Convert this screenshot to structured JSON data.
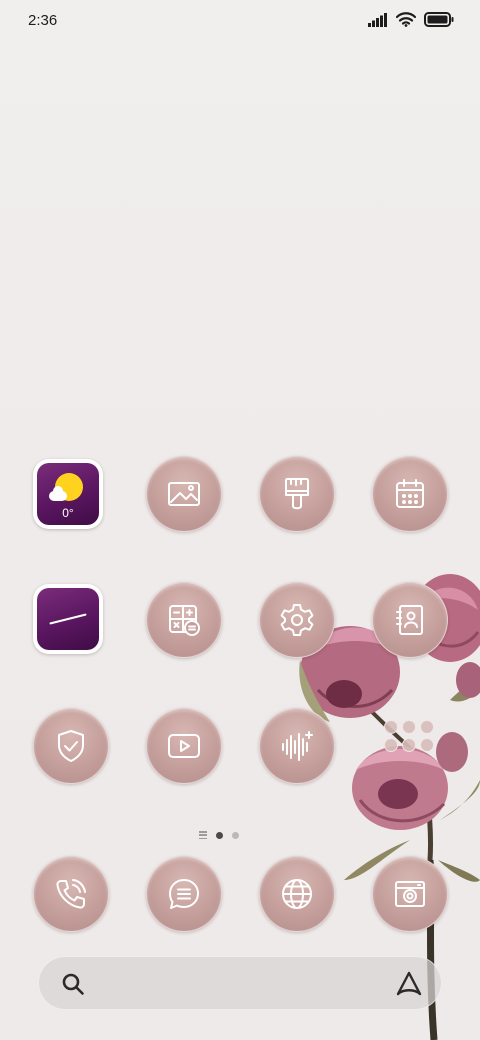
{
  "status_bar": {
    "time": "2:36",
    "icons": [
      "signal-icon",
      "wifi-icon",
      "battery-icon"
    ]
  },
  "apps": [
    {
      "id": "weather",
      "icon": "weather-icon",
      "temperature": "0°"
    },
    {
      "id": "gallery",
      "icon": "gallery-icon"
    },
    {
      "id": "themes",
      "icon": "paint-brush-icon"
    },
    {
      "id": "calendar",
      "icon": "calendar-icon"
    },
    {
      "id": "clock",
      "icon": "clock-icon"
    },
    {
      "id": "calculator",
      "icon": "calculator-icon"
    },
    {
      "id": "settings",
      "icon": "gear-icon"
    },
    {
      "id": "contacts",
      "icon": "contacts-book-icon"
    },
    {
      "id": "security",
      "icon": "shield-check-icon"
    },
    {
      "id": "video",
      "icon": "play-icon"
    },
    {
      "id": "recorder",
      "icon": "sound-wave-icon"
    },
    {
      "id": "folder",
      "icon": "folder-icon"
    }
  ],
  "page_indicator": {
    "pages": 2,
    "current": 1
  },
  "dock": [
    {
      "id": "phone",
      "icon": "phone-icon"
    },
    {
      "id": "messages",
      "icon": "message-icon"
    },
    {
      "id": "browser",
      "icon": "globe-icon"
    },
    {
      "id": "camera",
      "icon": "camera-icon"
    }
  ],
  "search": {
    "icons": [
      "search-icon",
      "assistant-icon"
    ]
  },
  "colors": {
    "wallpaper": "#efebeb",
    "icon_circle": "#c49e9a",
    "widget_purple": "#5a1660",
    "sun_yellow": "#ffd21f"
  }
}
